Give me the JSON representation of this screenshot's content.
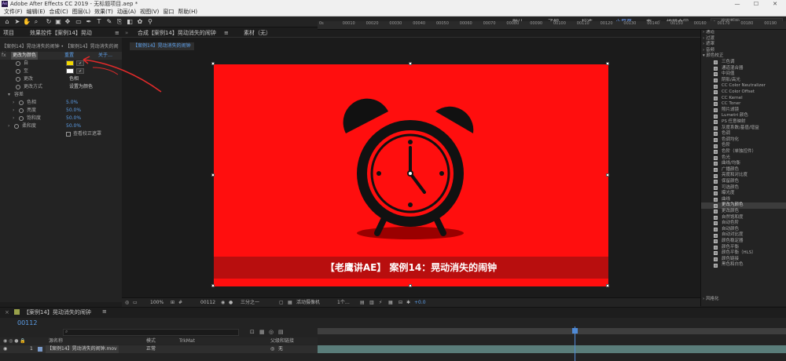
{
  "titlebar": {
    "logo": "Ae",
    "title": "Adobe After Effects CC 2019 - 无标题项目.aep *",
    "minimize": "—",
    "maximize": "☐",
    "close": "✕"
  },
  "menubar": {
    "items": [
      "文件(F)",
      "编辑(E)",
      "合成(C)",
      "图层(L)",
      "效果(T)",
      "动画(A)",
      "视图(V)",
      "窗口",
      "帮助(H)"
    ]
  },
  "toolbar": {
    "workspaces": [
      "默认",
      "了解",
      "标准",
      "小屏幕",
      "库",
      "»",
      "编辑合同"
    ],
    "active_workspace": "小屏幕",
    "search_placeholder": "搜索帮助"
  },
  "left_panel": {
    "tab_project": "项目",
    "tab_effects": "效果控件【案例14】晃动",
    "menu_icon": "≡",
    "layer_path": "【案例14】晃动消失的闹钟 • 【案例14】晃动消失的闹钟.aep",
    "effect_name": "更改为颜色",
    "reset_label": "重置",
    "about_label": "关于…",
    "from_label": "自",
    "to_label": "至",
    "change_label": "更改",
    "change_value": "色相",
    "change_by_label": "更改方式",
    "change_by_value": "设置为颜色",
    "tolerance_label": "容差",
    "hue_label": "色相",
    "hue_value": "5.0%",
    "lightness_label": "亮度",
    "lightness_value": "50.0%",
    "saturation_label": "饱和度",
    "saturation_value": "50.0%",
    "softness_label": "柔和度",
    "softness_value": "50.0%",
    "view_mask_label": "查看校正遮罩",
    "from_color": "#f2d800",
    "to_color": "#ffffff"
  },
  "comp_panel": {
    "tab_label": "合成【案例14】晃动消失的闹钟",
    "tab2_label": "素材（无）",
    "breadcrumb": "【案例14】晃动消失的闹钟",
    "caption": "【老鹰讲AE】 案例14：晃动消失的闹钟",
    "bg_color": "#ff0e0e",
    "footer": {
      "zoom": "100%",
      "timecode": "00112",
      "resolution": "三分之一",
      "camera": "活动摄像机",
      "views": "1个…",
      "exposure": "+0.0"
    }
  },
  "fx_panel": {
    "categories_top": [
      "通道",
      "过渡",
      "遮罩",
      "音频"
    ],
    "category_open": "颜色校正",
    "items": [
      "三色调",
      "通道混合器",
      "中间值",
      "阴影/高光",
      "CC Color Neutralizer",
      "CC Color Offset",
      "CC Kernel",
      "CC Toner",
      "照片滤镜",
      "Lumetri 颜色",
      "PS 任意映射",
      "灰度系数/基值/增益",
      "色调",
      "色调均化",
      "色阶",
      "色阶（单独控件）",
      "色光",
      "曲线/均衡",
      "广播颜色",
      "亮度和对比度",
      "保留颜色",
      "可选颜色",
      "曝光度",
      "曲线",
      "更改为颜色",
      "更改颜色",
      "自然饱和度",
      "自动色阶",
      "自动颜色",
      "自动对比度",
      "颜色稳定器",
      "颜色平衡",
      "颜色平衡（HLS）",
      "颜色链接",
      "黑色和白色"
    ],
    "selected_item": "更改为颜色",
    "category_bottom": "风格化"
  },
  "timeline": {
    "comp_tab": "【案例14】晃动消失的闹钟",
    "timecode": "00112",
    "search_placeholder": "",
    "col_source": "源名称",
    "col_mode": "模式",
    "col_trkmat": "TrkMat",
    "col_parent": "父级和链接",
    "layer_number": "1",
    "layer_name": "【案例14】晃动消失的闹钟.mov",
    "layer_mode": "正常",
    "layer_parent": "无",
    "ruler_ticks": [
      "0s",
      "00010",
      "00020",
      "00030",
      "00040",
      "00050",
      "00060",
      "00070",
      "00080",
      "00090",
      "00100",
      "00110",
      "00120",
      "00130",
      "00140",
      "00150",
      "00160",
      "00170",
      "00180",
      "00190"
    ]
  }
}
